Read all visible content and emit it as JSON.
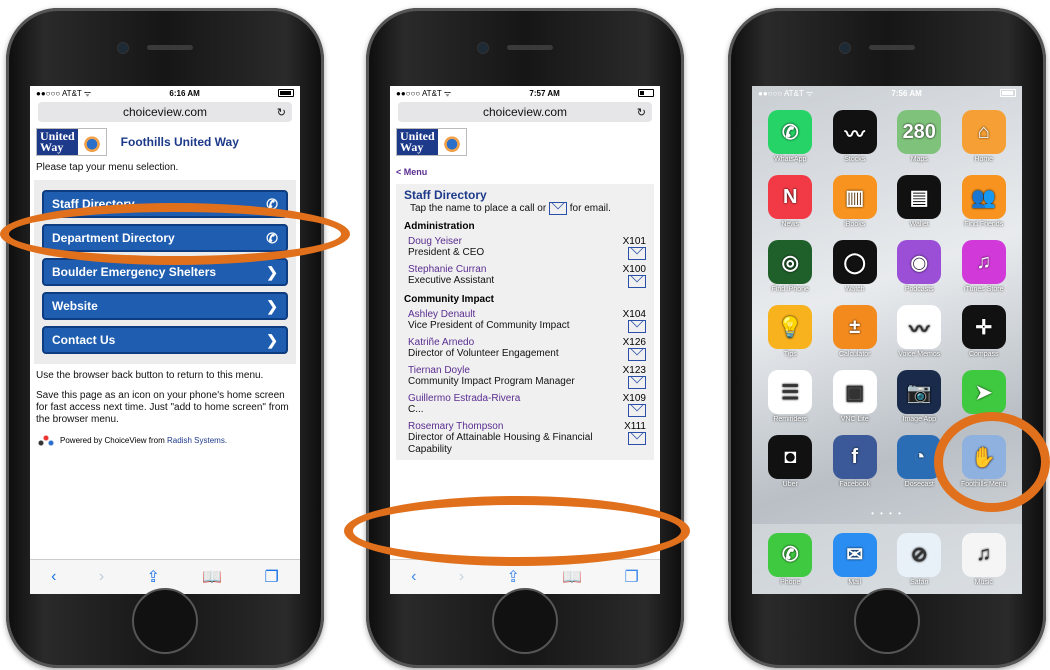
{
  "phone1": {
    "status": {
      "carrier": "●●○○○ AT&T ᯤ",
      "time": "6:16 AM"
    },
    "url": "choiceview.com",
    "logo": {
      "line1": "United",
      "line2": "Way"
    },
    "org_title": "Foothills United Way",
    "prompt": "Please tap your menu selection.",
    "menu": [
      {
        "label": "Staff Directory",
        "icon": "✆"
      },
      {
        "label": "Department Directory",
        "icon": "✆"
      },
      {
        "label": "Boulder Emergency Shelters",
        "icon": "❯"
      },
      {
        "label": "Website",
        "icon": "❯"
      },
      {
        "label": "Contact Us",
        "icon": "❯"
      }
    ],
    "back_note": "Use the browser back button to return to this menu.",
    "save_note": "Save this page as an icon on your phone's home screen for fast access next time. Just \"add to home screen\" from the browser menu.",
    "powered_prefix": "Powered by ChoiceView from ",
    "powered_link": "Radish Systems."
  },
  "phone2": {
    "status": {
      "carrier": "●●○○○ AT&T ᯤ",
      "time": "7:57 AM"
    },
    "url": "choiceview.com",
    "back_link": "< Menu",
    "title": "Staff Directory",
    "instruction_a": "Tap the name to place a call or",
    "instruction_b": "for email.",
    "sections": [
      {
        "name": "Administration",
        "people": [
          {
            "name": "Doug Yeiser",
            "role": "President & CEO",
            "ext": "X101"
          },
          {
            "name": "Stephanie Curran",
            "role": "Executive Assistant",
            "ext": "X100"
          }
        ]
      },
      {
        "name": "Community Impact",
        "people": [
          {
            "name": "Ashley Denault",
            "role": "Vice President of Community Impact",
            "ext": "X104"
          },
          {
            "name": "Katriñe Arnedo",
            "role": "Director of Volunteer Engagement",
            "ext": "X126"
          },
          {
            "name": "Tiernan Doyle",
            "role": "Community Impact Program Manager",
            "ext": "X123"
          },
          {
            "name": "Guillermo Estrada-Rivera",
            "role": "C...",
            "ext": "X109"
          },
          {
            "name": "Rosemary Thompson",
            "role": "Director of Attainable Housing & Financial Capability",
            "ext": "X111"
          }
        ]
      }
    ]
  },
  "phone3": {
    "status": {
      "carrier": "●●○○○ AT&T ᯤ",
      "time": "7:56 AM"
    },
    "apps": [
      {
        "label": "WhatsApp",
        "color": "#25d366",
        "glyph": "✆"
      },
      {
        "label": "Stocks",
        "color": "#111111",
        "glyph": "〰"
      },
      {
        "label": "Maps",
        "color": "#7fc27b",
        "glyph": "280"
      },
      {
        "label": "Home",
        "color": "#f59f35",
        "glyph": "⌂"
      },
      {
        "label": "News",
        "color": "#f13a46",
        "glyph": "N"
      },
      {
        "label": "iBooks",
        "color": "#f7931e",
        "glyph": "▥"
      },
      {
        "label": "Wallet",
        "color": "#111111",
        "glyph": "▤"
      },
      {
        "label": "Find Friends",
        "color": "#f7931e",
        "glyph": "👥"
      },
      {
        "label": "Find iPhone",
        "color": "#1f5f2a",
        "glyph": "◎"
      },
      {
        "label": "Watch",
        "color": "#111111",
        "glyph": "◯"
      },
      {
        "label": "Podcasts",
        "color": "#9b4fd6",
        "glyph": "◉"
      },
      {
        "label": "iTunes Store",
        "color": "#d13ad8",
        "glyph": "♫"
      },
      {
        "label": "Tips",
        "color": "#f7b21e",
        "glyph": "💡"
      },
      {
        "label": "Calculator",
        "color": "#f28a1e",
        "glyph": "±"
      },
      {
        "label": "Voice Memos",
        "color": "#ffffff",
        "glyph": "〰"
      },
      {
        "label": "Compass",
        "color": "#111111",
        "glyph": "✛"
      },
      {
        "label": "Reminders",
        "color": "#ffffff",
        "glyph": "☰"
      },
      {
        "label": "VNC Lite",
        "color": "#ffffff",
        "glyph": "▣"
      },
      {
        "label": "Image App",
        "color": "#1a2a4a",
        "glyph": "📷"
      },
      {
        "label": "",
        "color": "#3fc940",
        "glyph": "➤"
      },
      {
        "label": "Uber",
        "color": "#111111",
        "glyph": "◘"
      },
      {
        "label": "Facebook",
        "color": "#3b5998",
        "glyph": "f"
      },
      {
        "label": "Dosecast",
        "color": "#2b6db5",
        "glyph": "◔"
      },
      {
        "label": "Foothills Menu",
        "color": "#8fb1e0",
        "glyph": "✋"
      }
    ],
    "dock": [
      {
        "label": "Phone",
        "color": "#3fc940",
        "glyph": "✆"
      },
      {
        "label": "Mail",
        "color": "#2a8df2",
        "glyph": "✉"
      },
      {
        "label": "Safari",
        "color": "#e8f0f8",
        "glyph": "⊘"
      },
      {
        "label": "Music",
        "color": "#f5f5f5",
        "glyph": "♫"
      }
    ]
  }
}
